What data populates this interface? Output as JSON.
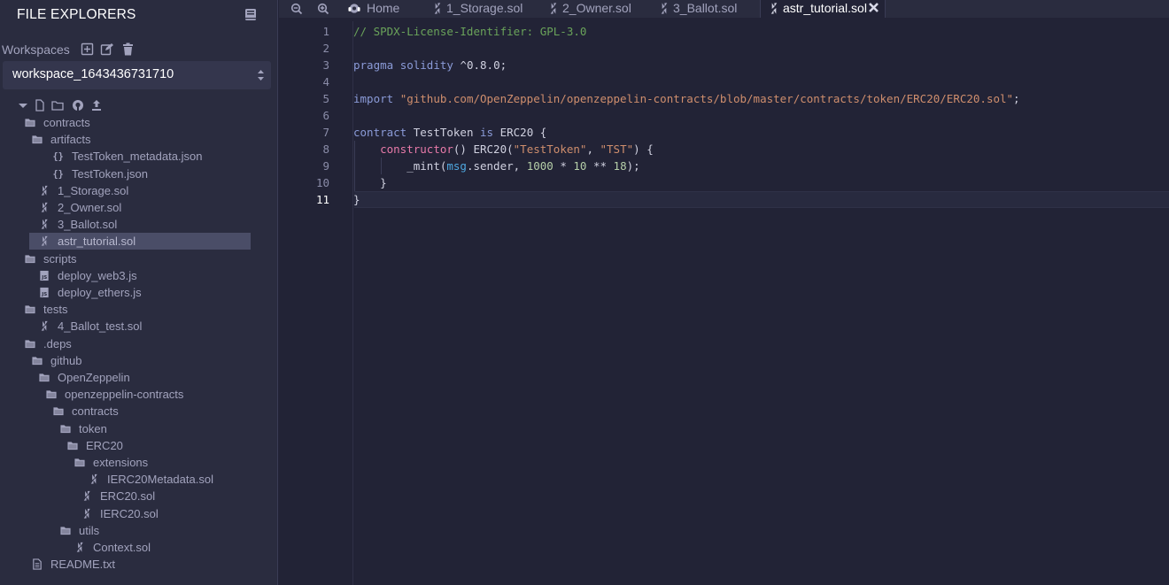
{
  "sidebar": {
    "title": "FILE EXPLORERS",
    "workspaces_label": "Workspaces",
    "workspace_selected": "workspace_1643436731710",
    "tree": [
      {
        "label": "contracts",
        "type": "folder"
      },
      {
        "label": "artifacts",
        "type": "folder"
      },
      {
        "label": "TestToken_metadata.json",
        "type": "json"
      },
      {
        "label": "TestToken.json",
        "type": "json"
      },
      {
        "label": "1_Storage.sol",
        "type": "sol"
      },
      {
        "label": "2_Owner.sol",
        "type": "sol"
      },
      {
        "label": "3_Ballot.sol",
        "type": "sol"
      },
      {
        "label": "astr_tutorial.sol",
        "type": "sol",
        "selected": true
      },
      {
        "label": "scripts",
        "type": "folder"
      },
      {
        "label": "deploy_web3.js",
        "type": "js"
      },
      {
        "label": "deploy_ethers.js",
        "type": "js"
      },
      {
        "label": "tests",
        "type": "folder"
      },
      {
        "label": "4_Ballot_test.sol",
        "type": "sol"
      },
      {
        "label": ".deps",
        "type": "folder"
      },
      {
        "label": "github",
        "type": "folder"
      },
      {
        "label": "OpenZeppelin",
        "type": "folder"
      },
      {
        "label": "openzeppelin-contracts",
        "type": "folder"
      },
      {
        "label": "contracts",
        "type": "folder"
      },
      {
        "label": "token",
        "type": "folder"
      },
      {
        "label": "ERC20",
        "type": "folder"
      },
      {
        "label": "extensions",
        "type": "folder"
      },
      {
        "label": "IERC20Metadata.sol",
        "type": "sol"
      },
      {
        "label": "ERC20.sol",
        "type": "sol"
      },
      {
        "label": "IERC20.sol",
        "type": "sol"
      },
      {
        "label": "utils",
        "type": "folder"
      },
      {
        "label": "Context.sol",
        "type": "sol"
      },
      {
        "label": "README.txt",
        "type": "txt"
      }
    ]
  },
  "tabs": [
    {
      "label": "Home",
      "icon": "remix-logo-icon"
    },
    {
      "label": "1_Storage.sol",
      "icon": "solidity-icon"
    },
    {
      "label": "2_Owner.sol",
      "icon": "solidity-icon"
    },
    {
      "label": "3_Ballot.sol",
      "icon": "solidity-icon"
    },
    {
      "label": "astr_tutorial.sol",
      "icon": "solidity-icon",
      "active": true
    }
  ],
  "editor": {
    "active_line": 11,
    "line_numbers": [
      "1",
      "2",
      "3",
      "4",
      "5",
      "6",
      "7",
      "8",
      "9",
      "10",
      "11"
    ],
    "code": {
      "l1_comment": "// SPDX-License-Identifier: GPL-3.0",
      "l3_kw1": "pragma",
      "l3_kw2": "solidity",
      "l3_ver": "^0.8.0;",
      "l5_kw": "import",
      "l5_str": "\"github.com/OpenZeppelin/openzeppelin-contracts/blob/master/contracts/token/ERC20/ERC20.sol\"",
      "l5_end": ";",
      "l7_kw": "contract",
      "l7_name": " TestToken ",
      "l7_is": "is",
      "l7_rest": " ERC20 {",
      "l8_fn": "constructor",
      "l8_mid": "() ERC20(",
      "l8_s1": "\"TestToken\"",
      "l8_comma": ", ",
      "l8_s2": "\"TST\"",
      "l8_end": ") {",
      "l9_fn": "_mint(",
      "l9_msg": "msg",
      "l9_mid": ".sender, ",
      "l9_n1": "1000",
      "l9_op1": " * ",
      "l9_n2": "10",
      "l9_op2": " ** ",
      "l9_n3": "18",
      "l9_end": ");",
      "l10": "}",
      "l11": "}"
    }
  },
  "colors": {
    "sidebar_bg": "#2a2c3f",
    "editor_bg": "#222336",
    "selected_item": "#4a4d67",
    "comment": "#6aa35a",
    "keyword": "#8b9bd8",
    "string": "#cf8e6d",
    "number": "#b5cea8",
    "function": "#e87aa9"
  }
}
